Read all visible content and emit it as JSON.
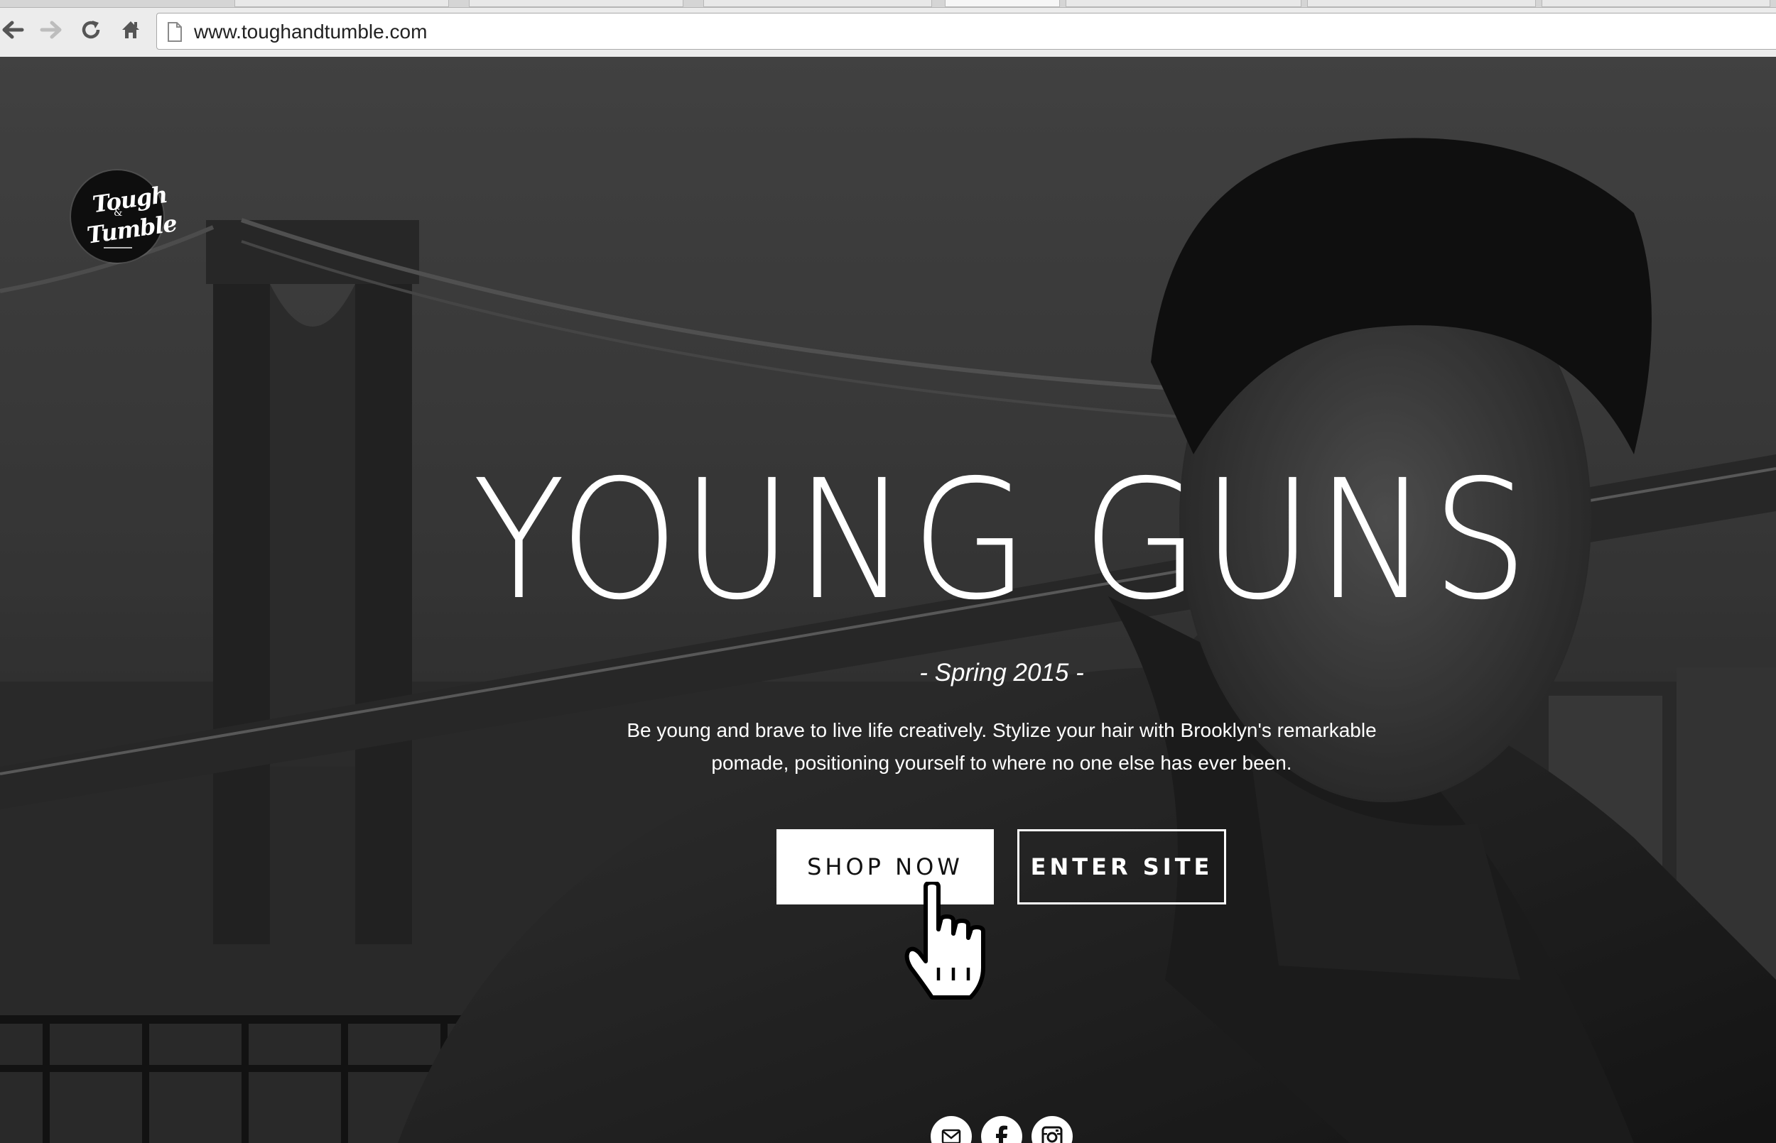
{
  "browser": {
    "url": "www.toughandtumble.com",
    "nav_icons": [
      "back-arrow-icon",
      "forward-arrow-icon",
      "reload-icon",
      "home-icon",
      "page-icon"
    ]
  },
  "logo": {
    "word1": "Tough",
    "amp": "&",
    "word2": "Tumble"
  },
  "hero": {
    "headline": "YOUNG GUNS",
    "subtitle": "- Spring 2015 -",
    "description": "Be young and brave to live life creatively. Stylize your hair with Brooklyn's remarkable pomade, positioning yourself to where no one else has ever been.",
    "shop_button": "SHOP NOW",
    "enter_button": "ENTER SITE"
  },
  "social": {
    "icons": [
      "mail-icon",
      "facebook-icon",
      "instagram-icon"
    ]
  },
  "colors": {
    "accent": "#ffffff",
    "overlay": "#000000",
    "button_text": "#111111"
  }
}
